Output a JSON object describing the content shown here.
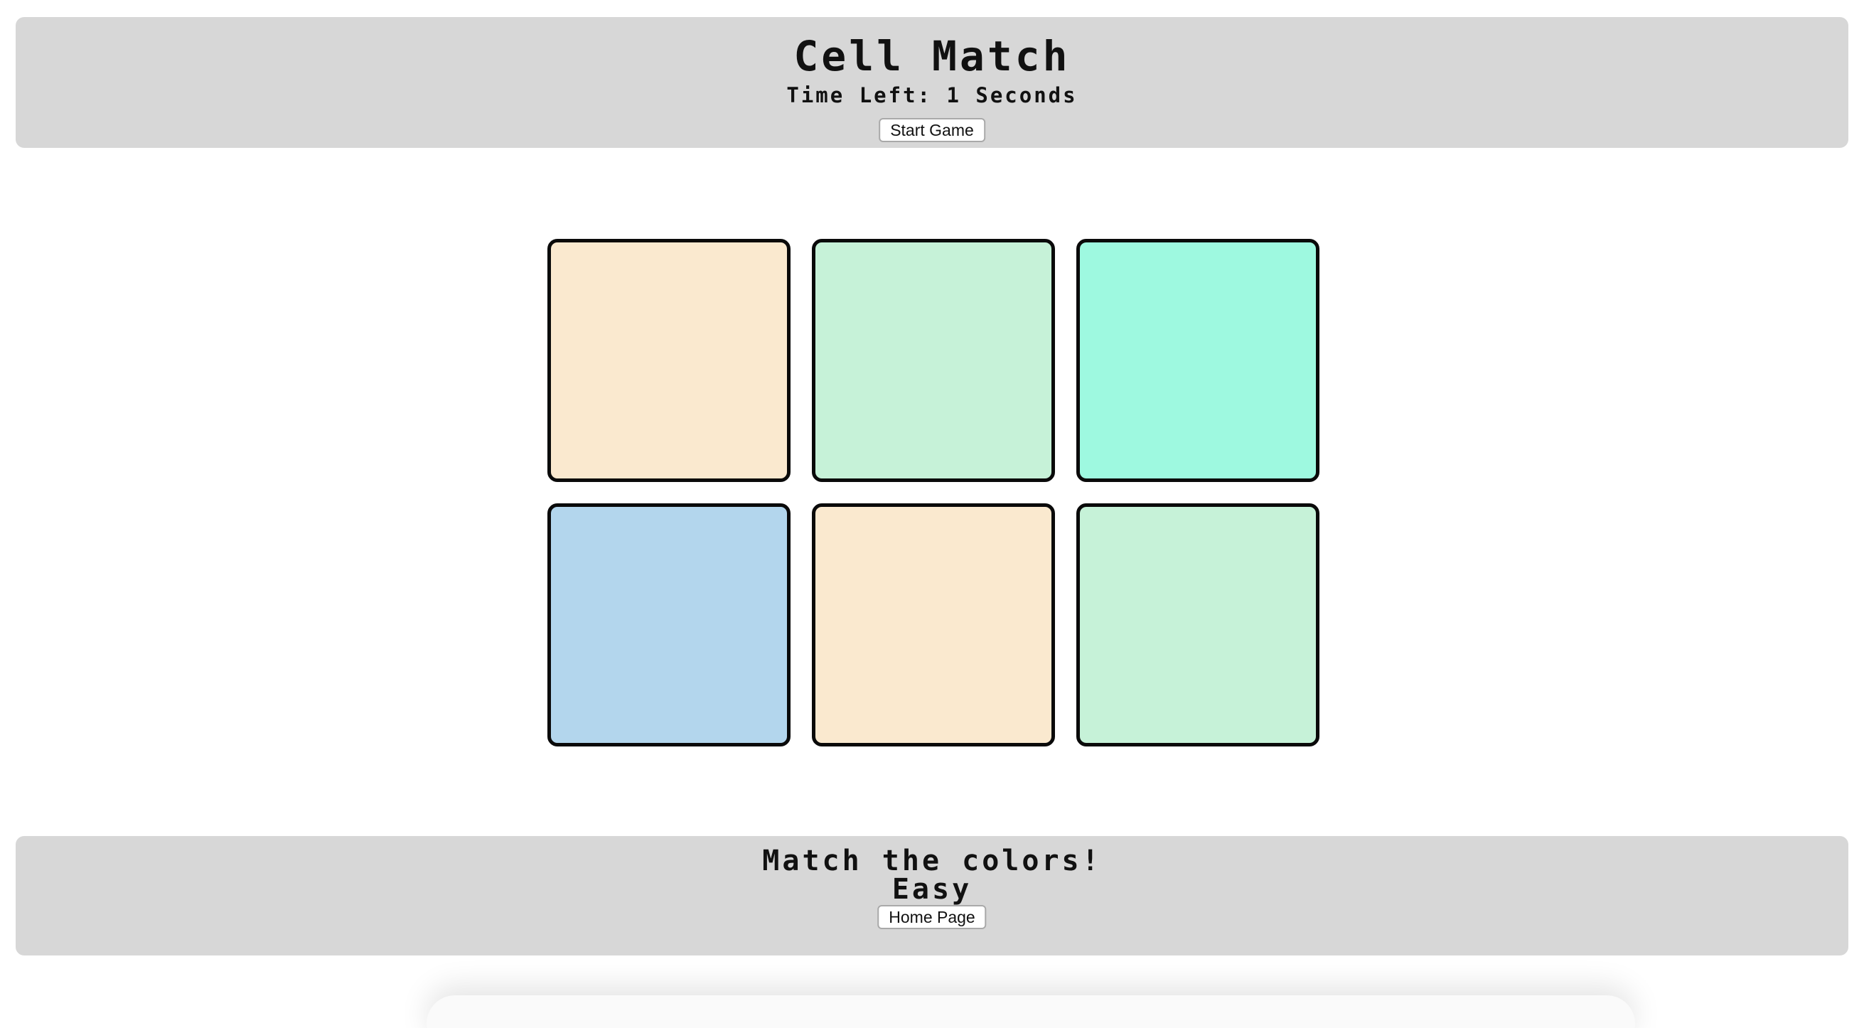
{
  "header": {
    "title": "Cell Match",
    "timer_text": "Time Left: 1 Seconds",
    "start_button_label": "Start Game"
  },
  "board": {
    "rows": 2,
    "columns": 3,
    "cells": [
      {
        "color": "#fae9cf"
      },
      {
        "color": "#c6f2d8"
      },
      {
        "color": "#9ef9e0"
      },
      {
        "color": "#b3d6ed"
      },
      {
        "color": "#fae9cf"
      },
      {
        "color": "#c6f2d8"
      }
    ]
  },
  "footer": {
    "message": "Match the colors!",
    "level": "Easy",
    "home_button_label": "Home Page"
  },
  "colors": {
    "panel_background": "#d7d7d7",
    "cell_border": "#0a0a0a",
    "page_background": "#ffffff"
  }
}
